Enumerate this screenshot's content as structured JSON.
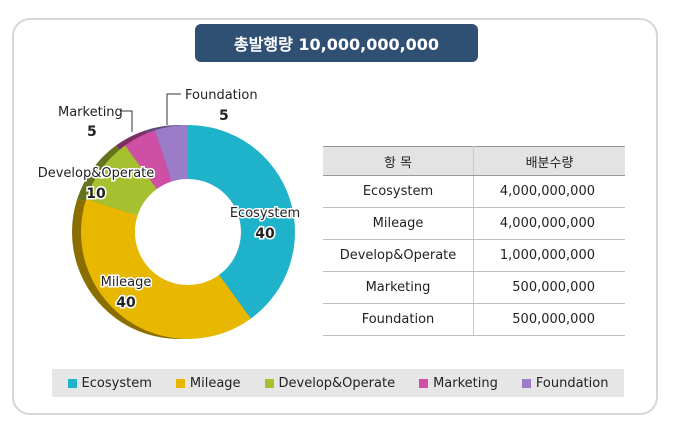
{
  "title": "총발행량 10,000,000,000",
  "chart_data": {
    "type": "pie",
    "title": "총발행량 10,000,000,000",
    "categories": [
      "Ecosystem",
      "Mileage",
      "Develop&Operate",
      "Marketing",
      "Foundation"
    ],
    "values": [
      40,
      40,
      10,
      5,
      5
    ],
    "colors": [
      "#1fb3cb",
      "#e8b800",
      "#a5c12f",
      "#cf4fa4",
      "#9a7cc9"
    ],
    "legend_position": "bottom"
  },
  "slice_labels": [
    {
      "name": "Ecosystem",
      "value": "40"
    },
    {
      "name": "Mileage",
      "value": "40"
    },
    {
      "name": "Develop&Operate",
      "value": "10"
    },
    {
      "name": "Marketing",
      "value": "5"
    },
    {
      "name": "Foundation",
      "value": "5"
    }
  ],
  "table": {
    "headers": [
      "항 목",
      "배분수량"
    ],
    "rows": [
      {
        "item": "Ecosystem",
        "amount": "4,000,000,000"
      },
      {
        "item": "Mileage",
        "amount": "4,000,000,000"
      },
      {
        "item": "Develop&Operate",
        "amount": "1,000,000,000"
      },
      {
        "item": "Marketing",
        "amount": "500,000,000"
      },
      {
        "item": "Foundation",
        "amount": "500,000,000"
      }
    ]
  },
  "legend": [
    "Ecosystem",
    "Mileage",
    "Develop&Operate",
    "Marketing",
    "Foundation"
  ]
}
